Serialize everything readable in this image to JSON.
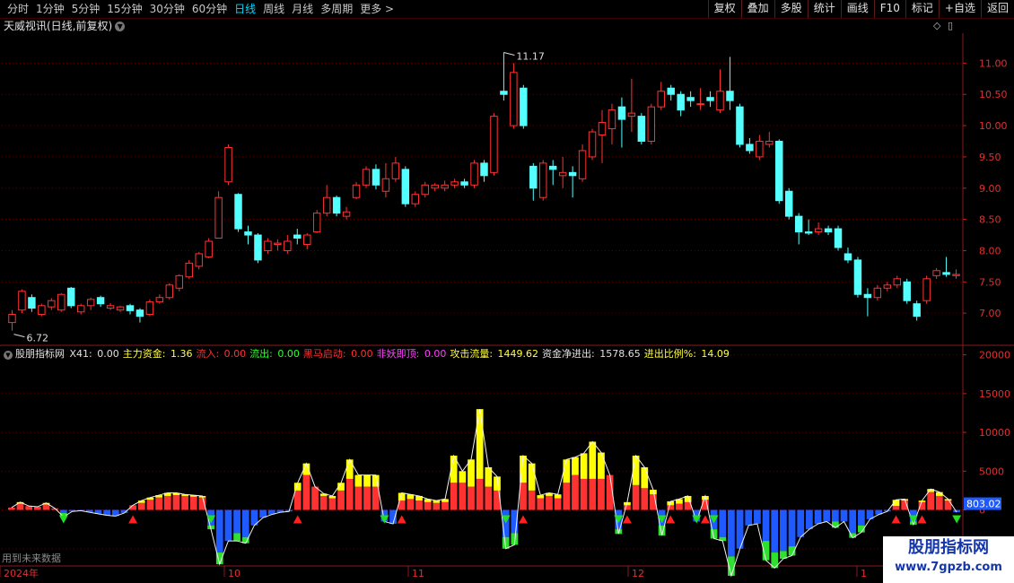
{
  "toolbar": {
    "periods": [
      "分时",
      "1分钟",
      "5分钟",
      "15分钟",
      "30分钟",
      "60分钟",
      "日线",
      "周线",
      "月线",
      "多周期",
      "更多"
    ],
    "active_period": "日线",
    "more_icon": "chevron-right-icon",
    "buttons": [
      "复权",
      "叠加",
      "多股",
      "统计",
      "画线",
      "F10",
      "标记",
      "+自选",
      "返回"
    ]
  },
  "chart_title": "天威视讯(日线,前复权)",
  "price_axis": {
    "ticks": [
      "11.00",
      "10.50",
      "10.00",
      "9.50",
      "9.00",
      "8.50",
      "8.00",
      "7.50",
      "7.00"
    ],
    "min": 6.5,
    "max": 11.45
  },
  "price_annotations": {
    "high": "11.17",
    "low": "6.72"
  },
  "indicator": {
    "name": "股朋指标网",
    "fields": [
      {
        "label": "X41:",
        "value": "0.00",
        "color": "#e0e0e0"
      },
      {
        "label": "主力资金:",
        "value": "1.36",
        "color": "#ffff40"
      },
      {
        "label": "流入:",
        "value": "0.00",
        "color": "#ff3030"
      },
      {
        "label": "流出:",
        "value": "0.00",
        "color": "#30ff30"
      },
      {
        "label": "黑马启动:",
        "value": "0.00",
        "color": "#ff3030"
      },
      {
        "label": "非妖即顶:",
        "value": "0.00",
        "color": "#ff40ff"
      },
      {
        "label": "攻击流量:",
        "value": "1449.62",
        "color": "#ffff40"
      },
      {
        "label": "资金净进出:",
        "value": "1578.65",
        "color": "#e0e0e0"
      },
      {
        "label": "进出比例%:",
        "value": "14.09",
        "color": "#ffff40"
      }
    ],
    "axis_ticks": [
      "20000",
      "15000",
      "10000",
      "5000",
      "0",
      "-5000"
    ],
    "current_value": "803.02"
  },
  "time_axis": [
    "2024年",
    "10",
    "11",
    "12",
    "1"
  ],
  "footnote": "用到未来数据",
  "watermark": {
    "line1": "股朋指标网",
    "line2": "www.7gpzb.com"
  },
  "colors": {
    "up": "#ff3232",
    "down": "#54ffff",
    "grid": "#5a0000",
    "yellow": "#ffff00",
    "blue": "#1e5aff",
    "green": "#30e030"
  },
  "chart_data": [
    {
      "type": "candlestick",
      "title": "天威视讯(日线,前复权)",
      "ylim": [
        6.5,
        11.45
      ],
      "candles": [
        {
          "o": 6.85,
          "c": 6.98,
          "h": 7.05,
          "l": 6.72
        },
        {
          "o": 7.05,
          "c": 7.35,
          "h": 7.38,
          "l": 7.0
        },
        {
          "o": 7.25,
          "c": 7.08,
          "h": 7.3,
          "l": 7.02
        },
        {
          "o": 6.98,
          "c": 7.12,
          "h": 7.15,
          "l": 6.95
        },
        {
          "o": 7.1,
          "c": 7.2,
          "h": 7.24,
          "l": 7.05
        },
        {
          "o": 7.05,
          "c": 7.3,
          "h": 7.32,
          "l": 7.02
        },
        {
          "o": 7.4,
          "c": 7.12,
          "h": 7.42,
          "l": 7.08
        },
        {
          "o": 7.02,
          "c": 7.12,
          "h": 7.15,
          "l": 6.98
        },
        {
          "o": 7.12,
          "c": 7.22,
          "h": 7.25,
          "l": 7.05
        },
        {
          "o": 7.25,
          "c": 7.15,
          "h": 7.28,
          "l": 7.1
        },
        {
          "o": 7.08,
          "c": 7.12,
          "h": 7.16,
          "l": 7.05
        },
        {
          "o": 7.05,
          "c": 7.1,
          "h": 7.12,
          "l": 7.02
        },
        {
          "o": 7.12,
          "c": 7.04,
          "h": 7.15,
          "l": 6.98
        },
        {
          "o": 7.05,
          "c": 6.95,
          "h": 7.08,
          "l": 6.85
        },
        {
          "o": 6.98,
          "c": 7.18,
          "h": 7.22,
          "l": 6.95
        },
        {
          "o": 7.18,
          "c": 7.25,
          "h": 7.3,
          "l": 7.15
        },
        {
          "o": 7.25,
          "c": 7.45,
          "h": 7.48,
          "l": 7.22
        },
        {
          "o": 7.4,
          "c": 7.6,
          "h": 7.62,
          "l": 7.35
        },
        {
          "o": 7.58,
          "c": 7.8,
          "h": 7.85,
          "l": 7.55
        },
        {
          "o": 7.75,
          "c": 7.95,
          "h": 7.98,
          "l": 7.7
        },
        {
          "o": 7.9,
          "c": 8.15,
          "h": 8.2,
          "l": 7.88
        },
        {
          "o": 8.2,
          "c": 8.85,
          "h": 8.95,
          "l": 8.5
        },
        {
          "o": 9.1,
          "c": 9.65,
          "h": 9.7,
          "l": 9.05
        },
        {
          "o": 8.9,
          "c": 8.35,
          "h": 8.92,
          "l": 8.3
        },
        {
          "o": 8.3,
          "c": 8.25,
          "h": 8.4,
          "l": 8.1
        },
        {
          "o": 8.25,
          "c": 7.85,
          "h": 8.28,
          "l": 7.8
        },
        {
          "o": 8.0,
          "c": 8.15,
          "h": 8.2,
          "l": 7.95
        },
        {
          "o": 8.1,
          "c": 8.12,
          "h": 8.18,
          "l": 8.0
        },
        {
          "o": 8.0,
          "c": 8.15,
          "h": 8.25,
          "l": 7.95
        },
        {
          "o": 8.25,
          "c": 8.2,
          "h": 8.35,
          "l": 8.1
        },
        {
          "o": 8.1,
          "c": 8.25,
          "h": 8.28,
          "l": 8.02
        },
        {
          "o": 8.3,
          "c": 8.6,
          "h": 8.65,
          "l": 8.28
        },
        {
          "o": 8.6,
          "c": 8.85,
          "h": 9.05,
          "l": 8.55
        },
        {
          "o": 8.85,
          "c": 8.6,
          "h": 8.88,
          "l": 8.55
        },
        {
          "o": 8.55,
          "c": 8.62,
          "h": 8.7,
          "l": 8.5
        },
        {
          "o": 8.85,
          "c": 9.05,
          "h": 9.1,
          "l": 8.82
        },
        {
          "o": 9.05,
          "c": 9.3,
          "h": 9.35,
          "l": 9.0
        },
        {
          "o": 9.3,
          "c": 9.05,
          "h": 9.38,
          "l": 8.98
        },
        {
          "o": 8.95,
          "c": 9.15,
          "h": 9.4,
          "l": 8.85
        },
        {
          "o": 9.15,
          "c": 9.4,
          "h": 9.5,
          "l": 9.1
        },
        {
          "o": 9.3,
          "c": 8.75,
          "h": 9.35,
          "l": 8.7
        },
        {
          "o": 8.75,
          "c": 8.9,
          "h": 8.95,
          "l": 8.7
        },
        {
          "o": 8.9,
          "c": 9.05,
          "h": 9.1,
          "l": 8.85
        },
        {
          "o": 9.0,
          "c": 9.05,
          "h": 9.08,
          "l": 8.95
        },
        {
          "o": 9.0,
          "c": 9.05,
          "h": 9.12,
          "l": 8.95
        },
        {
          "o": 9.05,
          "c": 9.1,
          "h": 9.15,
          "l": 9.0
        },
        {
          "o": 9.1,
          "c": 9.05,
          "h": 9.15,
          "l": 9.0
        },
        {
          "o": 9.05,
          "c": 9.4,
          "h": 9.45,
          "l": 9.0
        },
        {
          "o": 9.4,
          "c": 9.2,
          "h": 9.45,
          "l": 9.1
        },
        {
          "o": 9.25,
          "c": 10.15,
          "h": 10.2,
          "l": 9.2
        },
        {
          "o": 10.55,
          "c": 10.5,
          "h": 11.17,
          "l": 10.4
        },
        {
          "o": 10.0,
          "c": 10.85,
          "h": 11.0,
          "l": 9.95
        },
        {
          "o": 10.6,
          "c": 10.0,
          "h": 10.65,
          "l": 9.95
        },
        {
          "o": 9.35,
          "c": 9.0,
          "h": 9.4,
          "l": 8.8
        },
        {
          "o": 8.85,
          "c": 9.4,
          "h": 9.45,
          "l": 8.8
        },
        {
          "o": 9.35,
          "c": 9.3,
          "h": 9.45,
          "l": 9.05
        },
        {
          "o": 9.2,
          "c": 9.25,
          "h": 9.5,
          "l": 9.0
        },
        {
          "o": 9.25,
          "c": 9.2,
          "h": 9.35,
          "l": 8.85
        },
        {
          "o": 9.15,
          "c": 9.6,
          "h": 9.7,
          "l": 9.1
        },
        {
          "o": 9.5,
          "c": 9.9,
          "h": 9.95,
          "l": 9.45
        },
        {
          "o": 9.85,
          "c": 10.05,
          "h": 10.25,
          "l": 9.4
        },
        {
          "o": 9.95,
          "c": 10.25,
          "h": 10.35,
          "l": 9.7
        },
        {
          "o": 10.3,
          "c": 10.1,
          "h": 10.45,
          "l": 9.65
        },
        {
          "o": 10.15,
          "c": 10.2,
          "h": 10.75,
          "l": 9.9
        },
        {
          "o": 10.15,
          "c": 9.75,
          "h": 10.2,
          "l": 9.7
        },
        {
          "o": 9.75,
          "c": 10.3,
          "h": 10.35,
          "l": 9.7
        },
        {
          "o": 10.3,
          "c": 10.55,
          "h": 10.7,
          "l": 10.25
        },
        {
          "o": 10.6,
          "c": 10.5,
          "h": 10.65,
          "l": 10.4
        },
        {
          "o": 10.5,
          "c": 10.25,
          "h": 10.55,
          "l": 10.15
        },
        {
          "o": 10.45,
          "c": 10.4,
          "h": 10.55,
          "l": 10.3
        },
        {
          "o": 10.35,
          "c": 10.35,
          "h": 10.6,
          "l": 10.25
        },
        {
          "o": 10.45,
          "c": 10.4,
          "h": 10.55,
          "l": 10.3
        },
        {
          "o": 10.25,
          "c": 10.55,
          "h": 10.9,
          "l": 10.2
        },
        {
          "o": 10.55,
          "c": 10.4,
          "h": 11.1,
          "l": 10.25
        },
        {
          "o": 10.3,
          "c": 9.7,
          "h": 10.35,
          "l": 9.65
        },
        {
          "o": 9.7,
          "c": 9.6,
          "h": 9.8,
          "l": 9.55
        },
        {
          "o": 9.5,
          "c": 9.75,
          "h": 9.85,
          "l": 9.45
        },
        {
          "o": 9.7,
          "c": 9.75,
          "h": 9.9,
          "l": 9.65
        },
        {
          "o": 9.75,
          "c": 8.8,
          "h": 9.78,
          "l": 8.75
        },
        {
          "o": 8.95,
          "c": 8.55,
          "h": 9.0,
          "l": 8.5
        },
        {
          "o": 8.55,
          "c": 8.3,
          "h": 8.6,
          "l": 8.1
        },
        {
          "o": 8.3,
          "c": 8.28,
          "h": 8.5,
          "l": 8.25
        },
        {
          "o": 8.3,
          "c": 8.35,
          "h": 8.45,
          "l": 8.25
        },
        {
          "o": 8.35,
          "c": 8.3,
          "h": 8.4,
          "l": 8.25
        },
        {
          "o": 8.35,
          "c": 8.05,
          "h": 8.4,
          "l": 8.0
        },
        {
          "o": 7.95,
          "c": 7.85,
          "h": 8.05,
          "l": 7.8
        },
        {
          "o": 7.85,
          "c": 7.3,
          "h": 7.9,
          "l": 7.25
        },
        {
          "o": 7.3,
          "c": 7.25,
          "h": 7.4,
          "l": 6.95
        },
        {
          "o": 7.25,
          "c": 7.4,
          "h": 7.45,
          "l": 7.2
        },
        {
          "o": 7.4,
          "c": 7.45,
          "h": 7.5,
          "l": 7.35
        },
        {
          "o": 7.45,
          "c": 7.55,
          "h": 7.6,
          "l": 7.4
        },
        {
          "o": 7.5,
          "c": 7.2,
          "h": 7.55,
          "l": 7.15
        },
        {
          "o": 7.15,
          "c": 6.95,
          "h": 7.2,
          "l": 6.88
        },
        {
          "o": 7.2,
          "c": 7.55,
          "h": 7.6,
          "l": 7.15
        },
        {
          "o": 7.6,
          "c": 7.68,
          "h": 7.72,
          "l": 7.55
        },
        {
          "o": 7.65,
          "c": 7.62,
          "h": 7.9,
          "l": 7.58
        },
        {
          "o": 7.6,
          "c": 7.62,
          "h": 7.7,
          "l": 7.55
        }
      ]
    },
    {
      "type": "bar",
      "title": "股朋指标网",
      "ylim": [
        -7000,
        21000
      ],
      "main_values": [
        300,
        800,
        500,
        400,
        700,
        200,
        -400,
        -200,
        -100,
        -300,
        -500,
        -700,
        -800,
        -400,
        600,
        900,
        1300,
        1600,
        1800,
        1900,
        1800,
        1700,
        1600,
        -2000,
        -5500,
        -4000,
        -3000,
        -3500,
        -2000,
        -1000,
        -600,
        -300,
        -200,
        2500,
        4500,
        3000,
        1800,
        1500,
        2500,
        4000,
        3000,
        3000,
        3000,
        -1500,
        -1800,
        1200,
        1400,
        1200,
        1000,
        900,
        1000,
        3500,
        3500,
        3000,
        4000,
        3000,
        2500,
        -3500,
        -3000,
        3500,
        2500,
        1500,
        1800,
        1500,
        3500,
        4500,
        4000,
        4000,
        4000,
        4500,
        -2500,
        600,
        3200,
        2800,
        2000,
        -2000,
        600,
        800,
        1000,
        -1500,
        1300,
        -2500,
        -3500,
        -6000,
        -5000,
        -2000,
        -1800,
        -4000,
        -5500,
        -5300,
        -4700,
        -3500,
        -2500,
        -1800,
        -1500,
        -1500,
        -1500,
        -3000,
        -2000,
        -1200,
        -600,
        -200,
        500,
        1200,
        -1500,
        1000,
        2300,
        1800,
        1200,
        -300
      ],
      "yellow_extra": [
        0,
        200,
        0,
        0,
        200,
        0,
        0,
        0,
        0,
        0,
        0,
        0,
        0,
        0,
        0,
        300,
        300,
        300,
        400,
        300,
        200,
        200,
        200,
        0,
        0,
        0,
        0,
        0,
        0,
        0,
        0,
        0,
        0,
        1000,
        1500,
        0,
        300,
        300,
        1000,
        2500,
        1500,
        1500,
        1500,
        0,
        0,
        1000,
        600,
        600,
        400,
        300,
        400,
        3500,
        1500,
        3500,
        9000,
        2500,
        1800,
        0,
        0,
        3500,
        3500,
        400,
        400,
        500,
        3000,
        2300,
        3300,
        4800,
        3400,
        0,
        0,
        400,
        3800,
        2700,
        600,
        0,
        500,
        600,
        800,
        0,
        500,
        0,
        0,
        0,
        0,
        0,
        0,
        0,
        0,
        0,
        0,
        0,
        0,
        0,
        0,
        0,
        0,
        0,
        0,
        0,
        0,
        0,
        800,
        200,
        0,
        200,
        400,
        500,
        200,
        0
      ],
      "green_extra": [
        0,
        0,
        0,
        0,
        0,
        0,
        -500,
        0,
        0,
        0,
        0,
        0,
        0,
        0,
        0,
        0,
        0,
        0,
        0,
        0,
        0,
        0,
        0,
        -500,
        -1500,
        0,
        -1000,
        -800,
        0,
        0,
        0,
        0,
        0,
        0,
        0,
        0,
        0,
        0,
        0,
        0,
        0,
        0,
        0,
        0,
        0,
        -300,
        -1200,
        0,
        0,
        0,
        0,
        0,
        0,
        0,
        0,
        0,
        0,
        -1500,
        -1500,
        0,
        0,
        0,
        0,
        0,
        0,
        0,
        0,
        0,
        0,
        0,
        -600,
        0,
        0,
        0,
        0,
        -1300,
        0,
        0,
        0,
        0,
        0,
        -1200,
        -500,
        -2500,
        0,
        0,
        0,
        -2500,
        -2000,
        -1000,
        -1200,
        0,
        0,
        0,
        0,
        -800,
        0,
        -600,
        -900,
        0,
        0,
        0,
        0,
        0,
        -400,
        0,
        0,
        0,
        0,
        0
      ],
      "current_value": 803.02
    }
  ]
}
